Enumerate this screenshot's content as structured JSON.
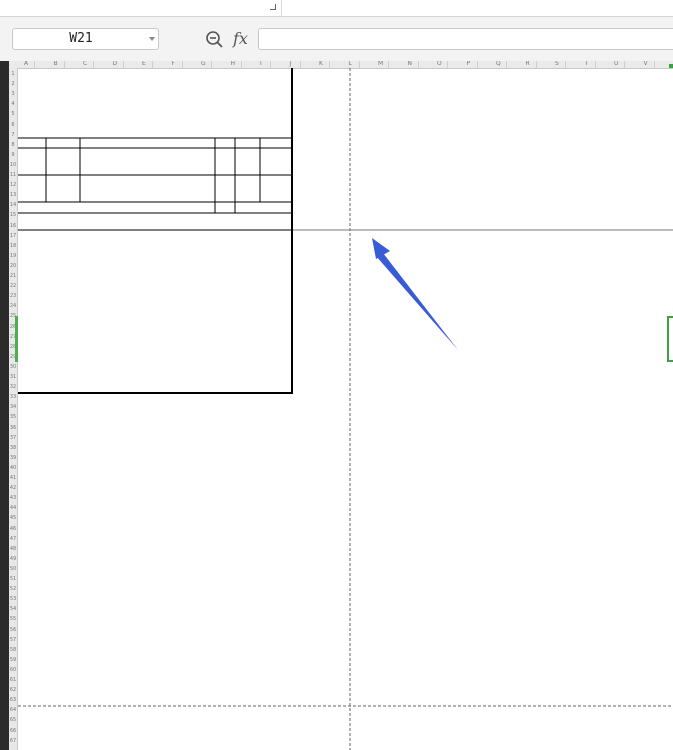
{
  "namebox": {
    "value": "W21"
  },
  "formula": {
    "value": ""
  },
  "icons": {
    "zoom": "zoom-out-magnifier-icon",
    "fx": "function-fx-icon",
    "fx_glyph": "fx"
  },
  "columns": [
    "A",
    "B",
    "C",
    "D",
    "E",
    "F",
    "G",
    "H",
    "I",
    "J",
    "K",
    "L",
    "M",
    "N",
    "O",
    "P",
    "Q",
    "R",
    "S",
    "T",
    "U",
    "V"
  ],
  "rows": [
    "1",
    "2",
    "3",
    "4",
    "5",
    "6",
    "7",
    "8",
    "9",
    "10",
    "11",
    "12",
    "13",
    "14",
    "15",
    "16",
    "17",
    "18",
    "19",
    "20",
    "21",
    "22",
    "23",
    "24",
    "25",
    "26",
    "27",
    "28",
    "29",
    "30",
    "31",
    "32",
    "33",
    "34",
    "35",
    "36",
    "37",
    "38",
    "39",
    "40",
    "41",
    "42",
    "43",
    "44",
    "45",
    "46",
    "47",
    "48",
    "49",
    "50",
    "51",
    "52",
    "53",
    "54",
    "55",
    "56",
    "57",
    "58",
    "59",
    "60",
    "61",
    "62",
    "63",
    "64",
    "65",
    "66",
    "67"
  ],
  "colors": {
    "arrow": "#3a5bd6",
    "selection": "#3ea043",
    "grid": "#cfcfcf"
  }
}
